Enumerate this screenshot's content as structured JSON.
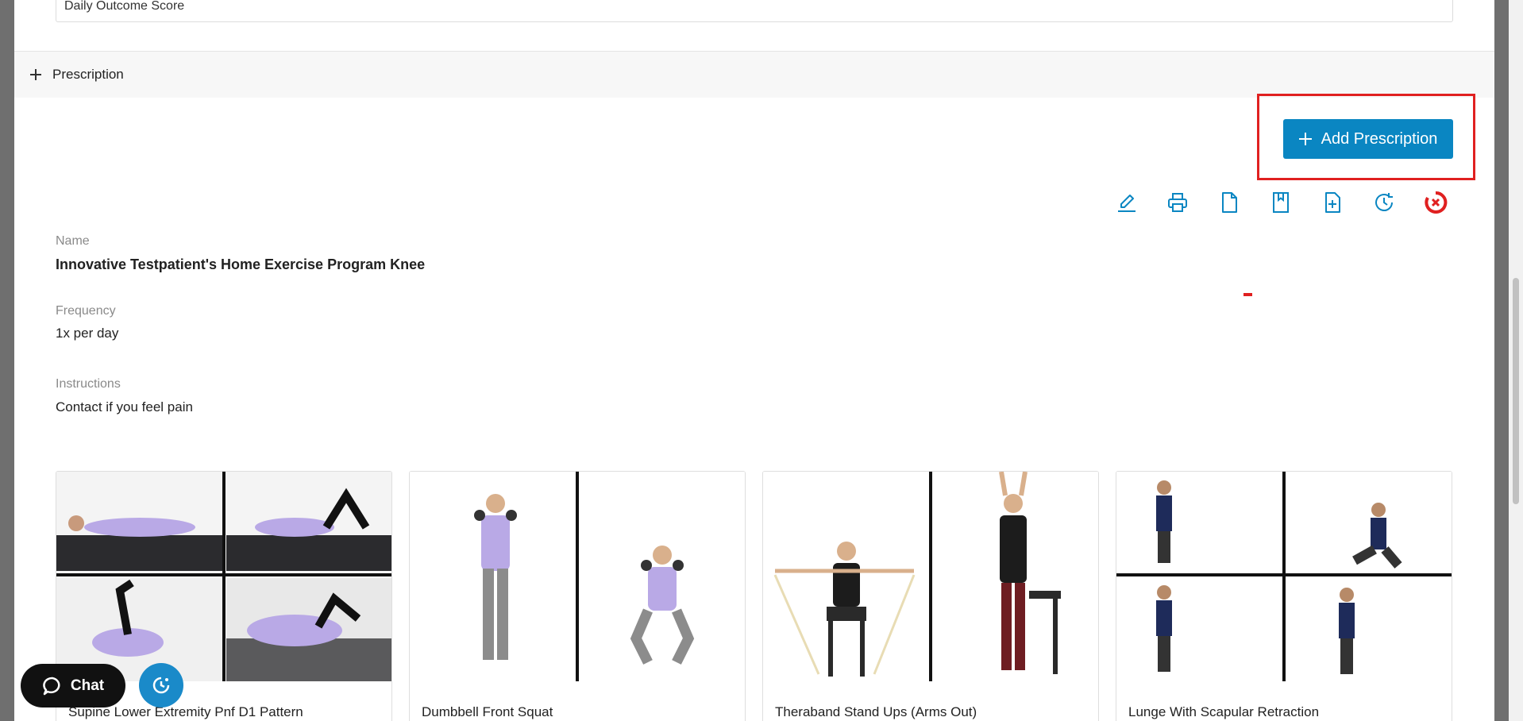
{
  "outcome": {
    "field_text": "Daily Outcome Score"
  },
  "prescription_section": {
    "title": "Prescription",
    "add_button_label": "Add Prescription"
  },
  "toolbar": {
    "icons": [
      "edit-icon",
      "print-icon",
      "document-icon",
      "bookmark-icon",
      "add-document-icon",
      "history-icon",
      "delete-icon"
    ],
    "accent_color": "#0a86c2",
    "delete_color": "#e02020"
  },
  "program": {
    "name_label": "Name",
    "name": "Innovative Testpatient's Home Exercise Program Knee",
    "frequency_label": "Frequency",
    "frequency": "1x per day",
    "instructions_label": "Instructions",
    "instructions": "Contact if you feel pain"
  },
  "exercises": [
    {
      "title": "Supine Lower Extremity Pnf D1 Pattern"
    },
    {
      "title": "Dumbbell Front Squat"
    },
    {
      "title": "Theraband Stand Ups (Arms Out)"
    },
    {
      "title": "Lunge With Scapular Retraction"
    }
  ],
  "widgets": {
    "chat_label": "Chat"
  }
}
